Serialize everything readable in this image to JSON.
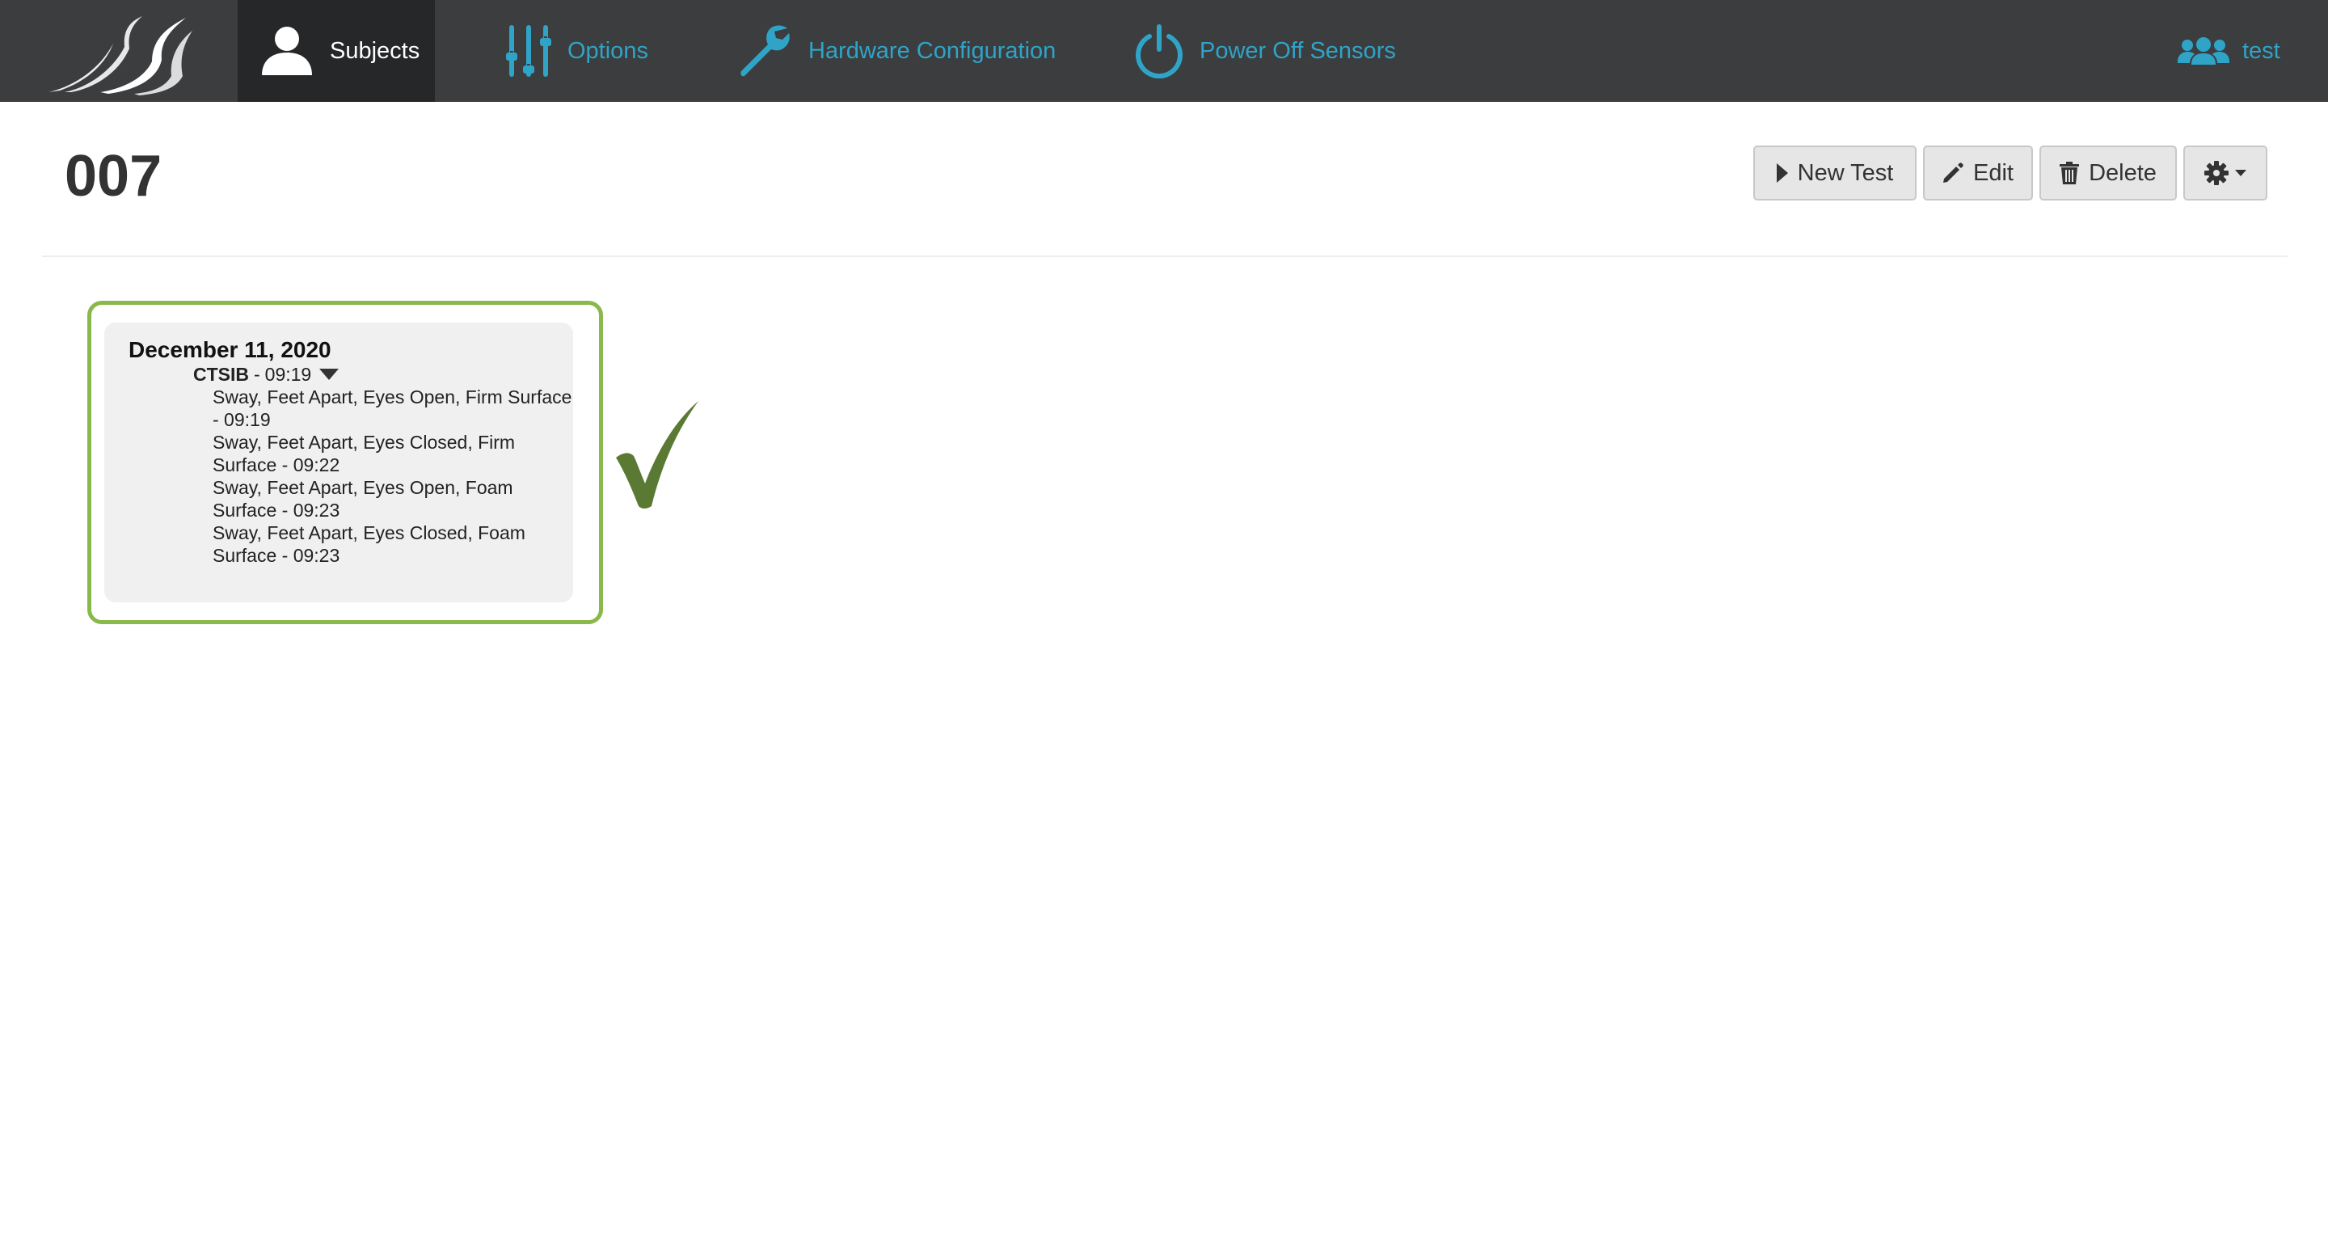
{
  "nav": {
    "items": [
      {
        "label": "Subjects",
        "icon": "user-icon",
        "active": true
      },
      {
        "label": "Options",
        "icon": "sliders-icon"
      },
      {
        "label": "Hardware Configuration",
        "icon": "wrench-icon"
      },
      {
        "label": "Power Off Sensors",
        "icon": "power-icon"
      }
    ],
    "user": {
      "label": "test",
      "icon": "users-icon"
    }
  },
  "subject": {
    "title": "007"
  },
  "toolbar": {
    "new_test": "New Test",
    "edit": "Edit",
    "delete": "Delete"
  },
  "session": {
    "date": "December 11, 2020",
    "protocol": {
      "name": "CTSIB",
      "separator": "-",
      "time": "09:19"
    },
    "trials": [
      {
        "text": "Sway, Feet Apart, Eyes Open, Firm Surface - 09:19"
      },
      {
        "text": "Sway, Feet Apart, Eyes Closed, Firm Surface - 09:22"
      },
      {
        "text": "Sway, Feet Apart, Eyes Open, Foam Surface - 09:23"
      },
      {
        "text": "Sway, Feet Apart, Eyes Closed, Foam Surface - 09:23"
      }
    ]
  },
  "colors": {
    "navbar": "#3b3d3f",
    "navbar_active": "#262728",
    "nav_link": "#2fa4c7",
    "card_border": "#8ab84a",
    "check_mark": "#5a7a34"
  }
}
